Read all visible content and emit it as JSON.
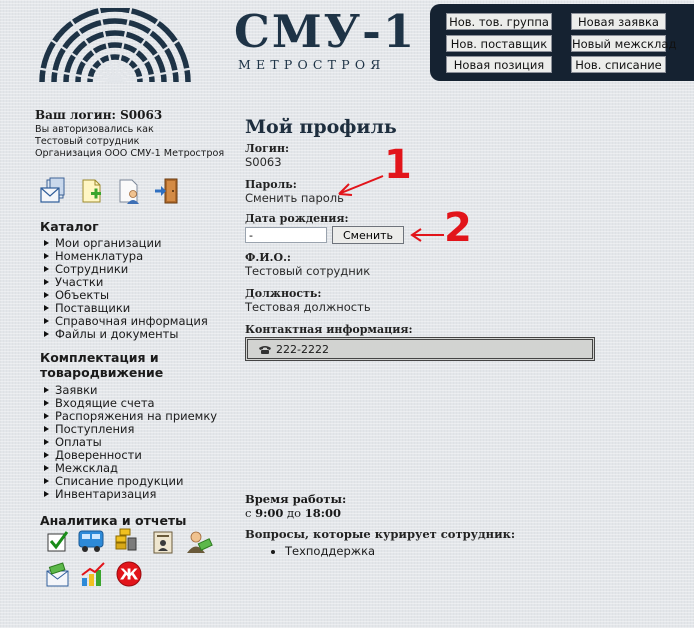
{
  "brand": {
    "name": "СМУ-1",
    "subtitle": "МЕТРОСТРОЯ"
  },
  "quick_actions": [
    "Нов. тов. группа",
    "Новая заявка",
    "Нов. поставщик",
    "Новый межсклад",
    "Новая позиция",
    "Нов. списание"
  ],
  "user": {
    "login_label": "Ваш логин:",
    "login": "S0063",
    "auth_text": "Вы авторизовались как",
    "name": "Тестовый сотрудник",
    "org_label": "Организация",
    "org": "ООО СМУ-1 Метростроя"
  },
  "toolbar_icons": [
    "mail-icon",
    "new-document-icon",
    "user-profile-icon",
    "exit-door-icon"
  ],
  "catalog": {
    "title": "Каталог",
    "items": [
      "Мои организации",
      "Номенклатура",
      "Сотрудники",
      "Участки",
      "Объекты",
      "Поставщики",
      "Справочная информация",
      "Файлы и документы"
    ]
  },
  "supply": {
    "title_line1": "Комплектация и",
    "title_line2": "товародвижение",
    "items": [
      "Заявки",
      "Входящие счета",
      "Распоряжения на приемку",
      "Поступления",
      "Оплаты",
      "Доверенности",
      "Межсклад",
      "Списание продукции",
      "Инвентаризация"
    ]
  },
  "analytics": {
    "title": "Аналитика и отчеты",
    "icons": [
      "checkbox-report-icon",
      "truck-icon",
      "warehouse-icon",
      "certificate-icon",
      "user-money-icon",
      "mail-money-icon",
      "growth-chart-icon",
      "stop-icon"
    ]
  },
  "profile": {
    "title": "Мой профиль",
    "login_label": "Логин:",
    "login_value": "S0063",
    "password_label": "Пароль:",
    "password_link": "Сменить пароль",
    "birth_label": "Дата рождения:",
    "birth_value": "-",
    "birth_button": "Сменить",
    "fio_label": "Ф.И.О.:",
    "fio_value": "Тестовый сотрудник",
    "position_label": "Должность:",
    "position_value": "Тестовая должность",
    "contacts_label": "Контактная информация:",
    "phone": "222-2222",
    "hours_label": "Время работы:",
    "hours_from_word": "с",
    "hours_from": "9:00",
    "hours_to_word": "до",
    "hours_to": "18:00",
    "questions_label": "Вопросы, которые курирует сотрудник:",
    "questions": [
      "Техподдержка"
    ]
  },
  "annotations": {
    "arrow1_number": "1",
    "arrow2_number": "2",
    "color": "#e2141a"
  }
}
